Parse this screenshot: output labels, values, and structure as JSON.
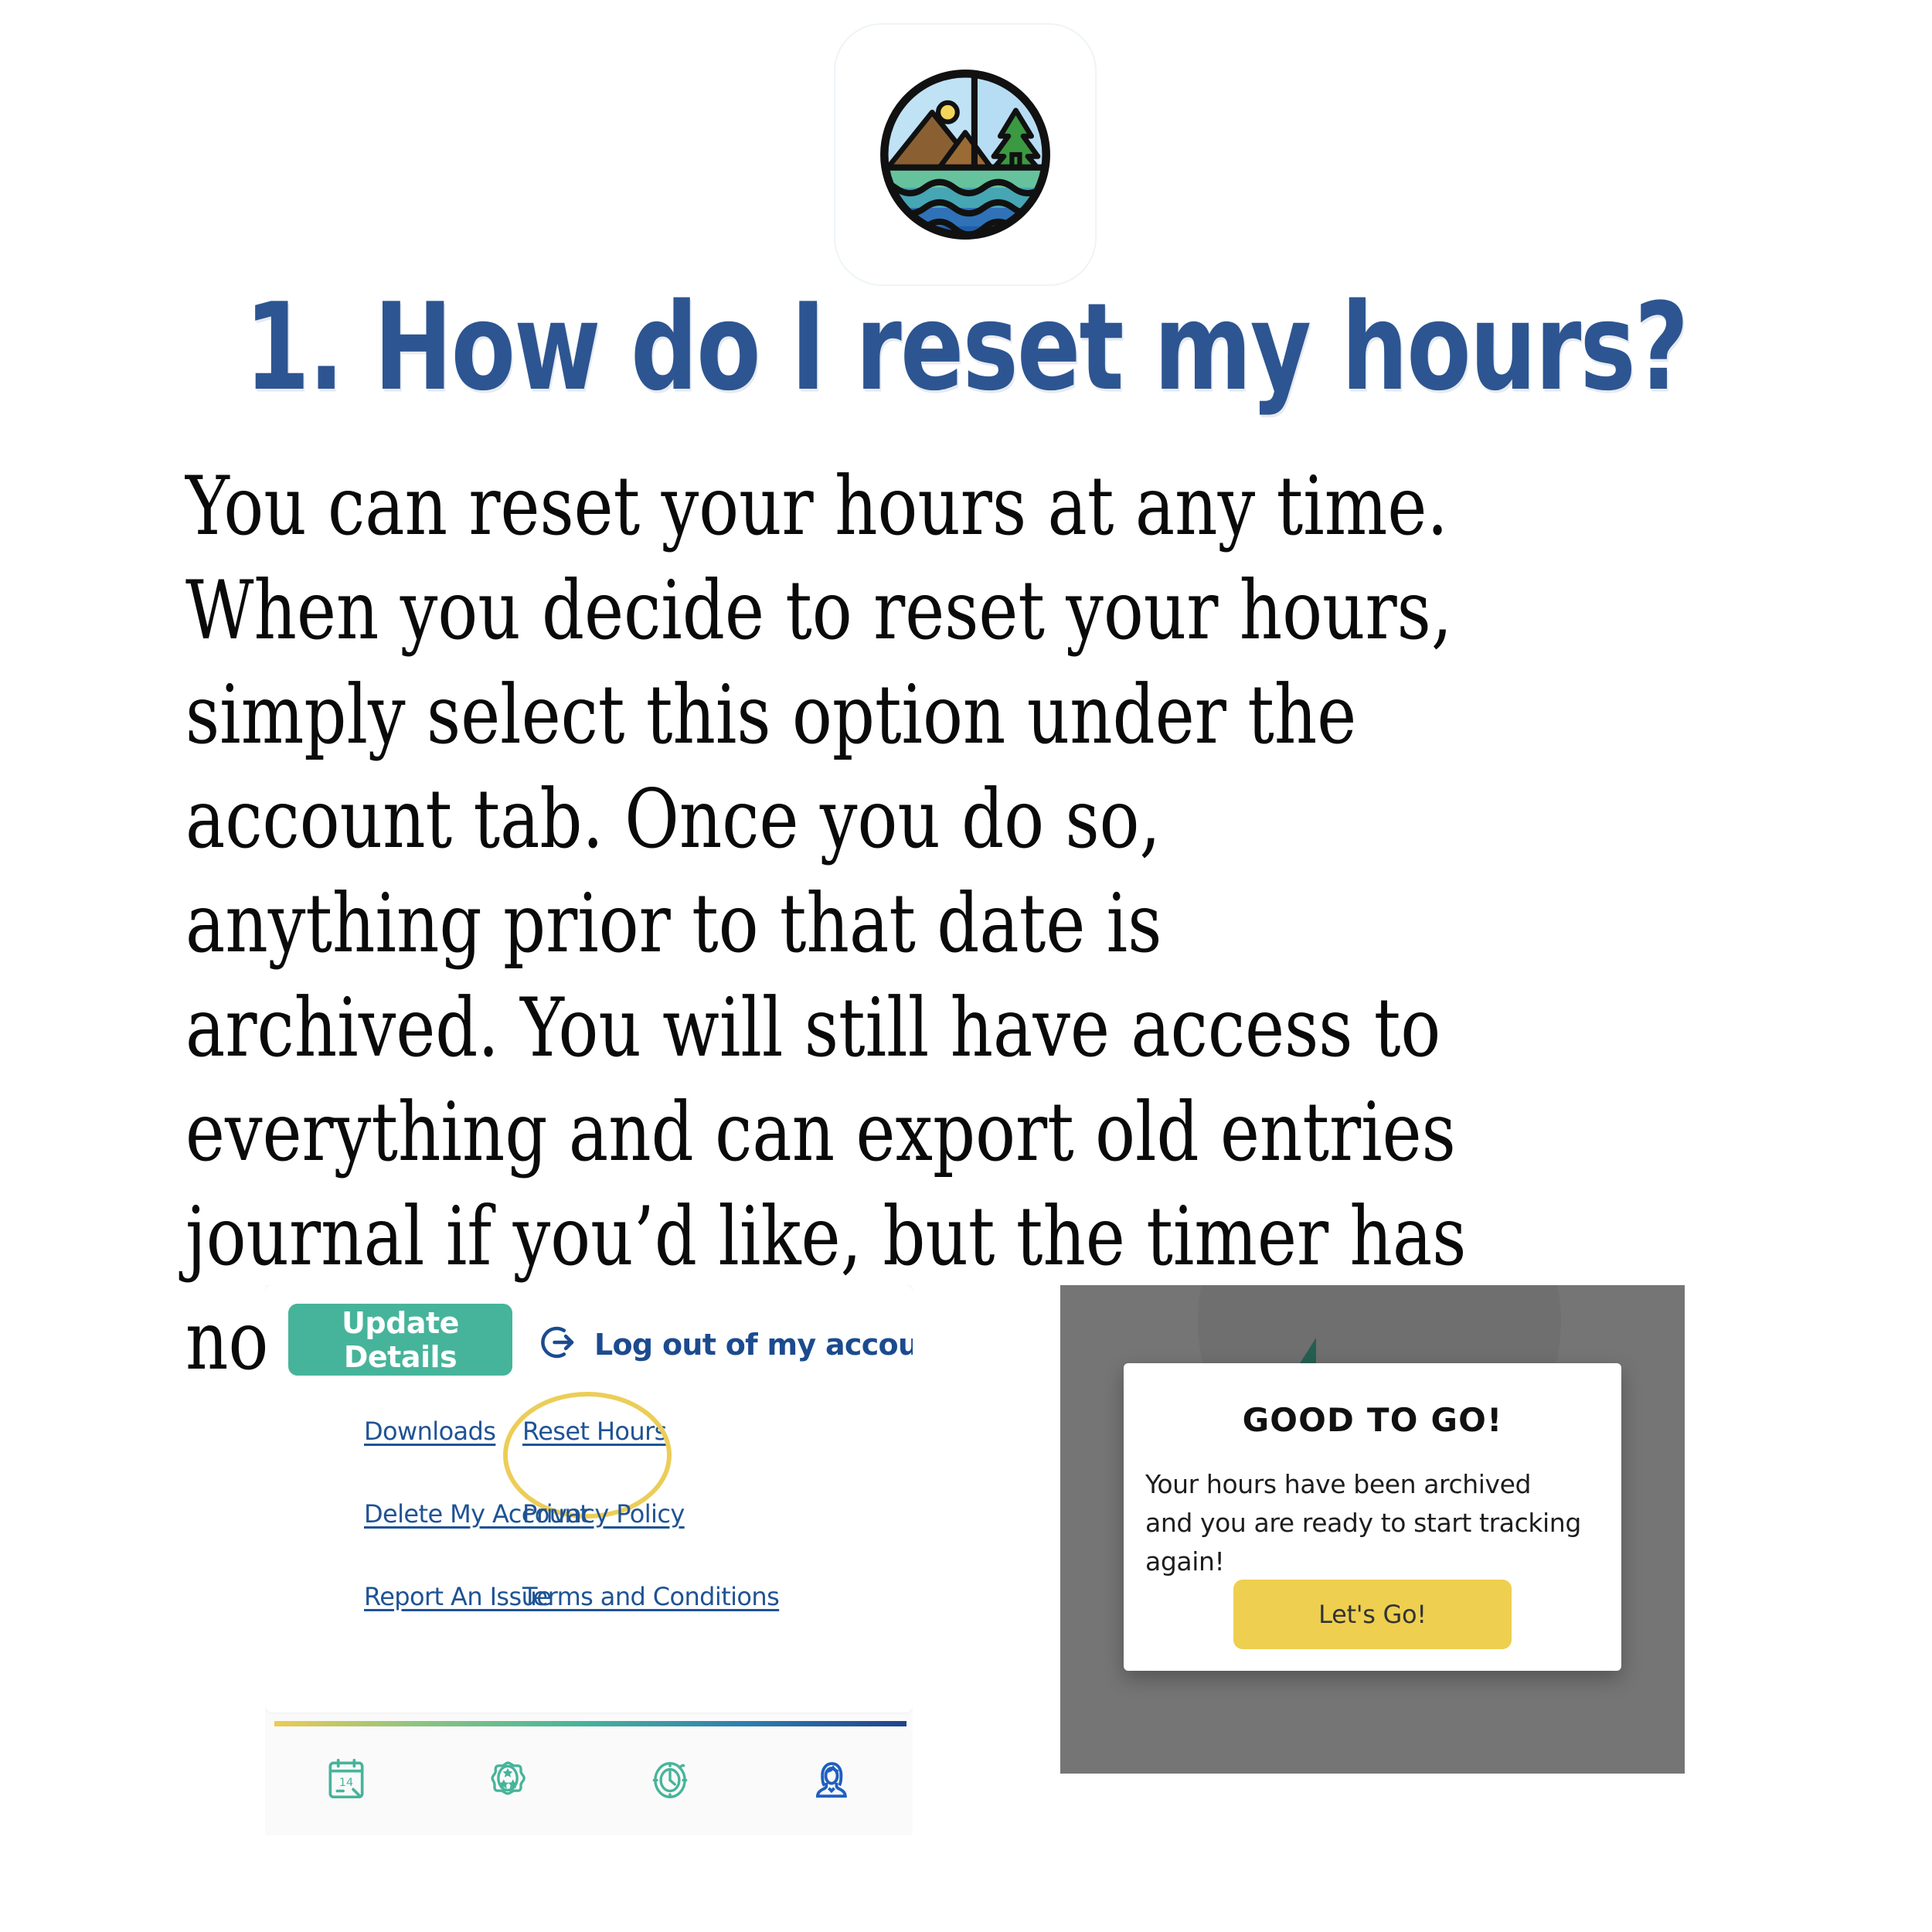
{
  "logo": {
    "name": "nature-scene-logo",
    "alt": "Circular badge showing mountains, sun, pine tree and water waves"
  },
  "heading": {
    "text": "1. How do I reset my hours?",
    "color": "#2d5591"
  },
  "body": {
    "paragraph": "You can reset your hours at any time. When you decide to reset your hours, simply select this option under the account tab. Once you do so, anything prior to that date is archived. You will still have access to everything and can export old entries journal if you’d like, but the timer has now reset to zero."
  },
  "screenshot_account": {
    "update_button": "Update Details",
    "logout_icon": "logout-icon",
    "logout_label": "Log out of my account",
    "links": [
      {
        "label": "Downloads",
        "highlighted": false
      },
      {
        "label": "Reset Hours",
        "highlighted": true
      },
      {
        "label": "Delete My Account",
        "highlighted": false
      },
      {
        "label": "Privacy Policy",
        "highlighted": false
      },
      {
        "label": "Report An Issue",
        "highlighted": false
      },
      {
        "label": "Terms and Conditions",
        "highlighted": false
      }
    ],
    "tabs": [
      {
        "icon": "calendar-icon",
        "day": "14"
      },
      {
        "icon": "award-badge-icon"
      },
      {
        "icon": "stopwatch-icon"
      },
      {
        "icon": "profile-avatar-icon",
        "active": true
      }
    ],
    "colors": {
      "button": "#46b49a",
      "link": "#1f5394",
      "highlight_ring": "#eccd58"
    }
  },
  "screenshot_modal": {
    "title": "GOOD TO GO!",
    "message": "Your hours have been archived and you are ready to start tracking again!",
    "button": "Let's Go!",
    "colors": {
      "overlay": "#757575",
      "button": "#eecf50"
    }
  }
}
